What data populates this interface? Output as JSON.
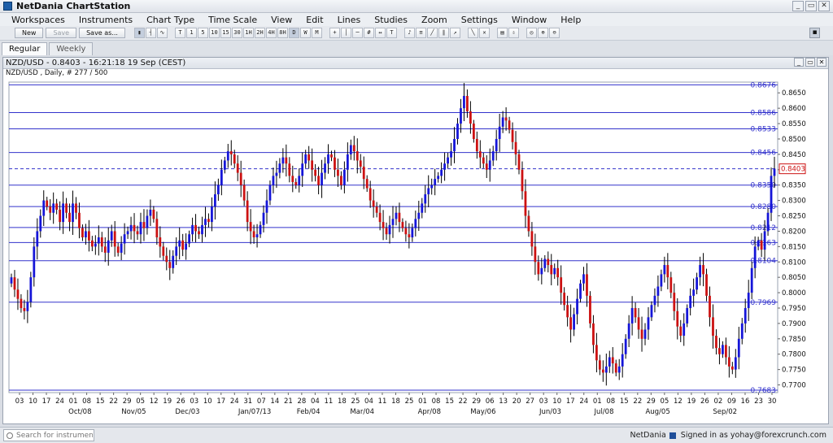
{
  "window": {
    "title": "NetDania ChartStation",
    "buttons": [
      "_",
      "▭",
      "✕"
    ]
  },
  "menu": [
    "Workspaces",
    "Instruments",
    "Chart Type",
    "Time Scale",
    "View",
    "Edit",
    "Lines",
    "Studies",
    "Zoom",
    "Settings",
    "Window",
    "Help"
  ],
  "toolbar": {
    "new_label": "New",
    "save_label": "Save",
    "save_as_label": "Save as...",
    "timescale_buttons": [
      "T",
      "1",
      "5",
      "10",
      "15",
      "30",
      "1H",
      "2H",
      "4H",
      "8H",
      "D",
      "W",
      "M"
    ],
    "active_timescale": "D"
  },
  "tabs": [
    {
      "label": "Regular",
      "active": true
    },
    {
      "label": "Weekly",
      "active": false
    }
  ],
  "chart_window": {
    "title": "NZD/USD - 0.8403 - 16:21:18  19 Sep (CEST)",
    "subtitle": "NZD/USD , Daily, # 277 / 500"
  },
  "status": {
    "search_placeholder": "Search for instrument",
    "brand": "NetDania",
    "signed_in": "Signed in as yohay@forexcrunch.com"
  },
  "chart_data": {
    "type": "candlestick",
    "instrument": "NZD/USD",
    "period": "Daily",
    "ylim": [
      0.7675,
      0.8685
    ],
    "y_ticks": [
      "0.8650",
      "0.8600",
      "0.8550",
      "0.8500",
      "0.8450",
      "0.8400",
      "0.8350",
      "0.8300",
      "0.8250",
      "0.8200",
      "0.8150",
      "0.8100",
      "0.8050",
      "0.8000",
      "0.7950",
      "0.7900",
      "0.7850",
      "0.7800",
      "0.7750",
      "0.7700"
    ],
    "x_tick_labels": [
      "03",
      "10",
      "17",
      "24",
      "01",
      "08",
      "15",
      "22",
      "29",
      "05",
      "12",
      "19",
      "26",
      "03",
      "10",
      "17",
      "24",
      "31",
      "07",
      "14",
      "21",
      "28",
      "04",
      "11",
      "18",
      "25",
      "04",
      "11",
      "18",
      "25",
      "01",
      "08",
      "15",
      "22",
      "29",
      "06",
      "13",
      "20",
      "27",
      "03",
      "10",
      "17",
      "24",
      "01",
      "08",
      "15",
      "22",
      "29",
      "05",
      "12",
      "19",
      "26",
      "02",
      "09",
      "16",
      "23",
      "30"
    ],
    "month_labels": [
      "Oct/08",
      "Nov/05",
      "Dec/03",
      "Jan/07/13",
      "Feb/04",
      "Mar/04",
      "Apr/08",
      "May/06",
      "Jun/03",
      "Jul/08",
      "Aug/05",
      "Sep/02"
    ],
    "horizontal_levels": [
      0.8676,
      0.8586,
      0.8533,
      0.8456,
      0.835,
      0.828,
      0.8212,
      0.8163,
      0.8104,
      0.7969,
      0.7683
    ],
    "horizontal_level_labels": [
      "0.8676",
      "0.8586",
      "0.8533",
      "0.8456",
      "0.8350",
      "0.8280",
      "0.8212",
      "0.8163",
      "0.8104",
      "0.7969",
      "0.7683"
    ],
    "current_price": 0.8403,
    "current_price_label": "0.8403",
    "up_color": "#1515d8",
    "down_color": "#cc1111",
    "level_color": "#3333cc",
    "closes": [
      0.805,
      0.801,
      0.798,
      0.795,
      0.794,
      0.797,
      0.805,
      0.815,
      0.82,
      0.825,
      0.83,
      0.828,
      0.826,
      0.829,
      0.827,
      0.823,
      0.829,
      0.826,
      0.823,
      0.829,
      0.826,
      0.821,
      0.818,
      0.82,
      0.817,
      0.815,
      0.816,
      0.818,
      0.815,
      0.813,
      0.817,
      0.82,
      0.815,
      0.813,
      0.816,
      0.819,
      0.82,
      0.822,
      0.82,
      0.819,
      0.823,
      0.821,
      0.825,
      0.827,
      0.824,
      0.818,
      0.815,
      0.812,
      0.81,
      0.808,
      0.812,
      0.815,
      0.817,
      0.814,
      0.816,
      0.819,
      0.822,
      0.82,
      0.819,
      0.822,
      0.824,
      0.823,
      0.828,
      0.832,
      0.835,
      0.84,
      0.843,
      0.846,
      0.845,
      0.842,
      0.839,
      0.835,
      0.83,
      0.823,
      0.82,
      0.818,
      0.819,
      0.822,
      0.826,
      0.83,
      0.835,
      0.838,
      0.839,
      0.842,
      0.844,
      0.842,
      0.838,
      0.836,
      0.835,
      0.838,
      0.842,
      0.845,
      0.843,
      0.84,
      0.838,
      0.835,
      0.839,
      0.842,
      0.845,
      0.844,
      0.84,
      0.838,
      0.835,
      0.84,
      0.845,
      0.848,
      0.846,
      0.843,
      0.841,
      0.837,
      0.834,
      0.83,
      0.828,
      0.826,
      0.823,
      0.821,
      0.819,
      0.822,
      0.824,
      0.826,
      0.823,
      0.821,
      0.819,
      0.818,
      0.821,
      0.824,
      0.826,
      0.829,
      0.832,
      0.834,
      0.835,
      0.837,
      0.838,
      0.84,
      0.842,
      0.844,
      0.846,
      0.85,
      0.855,
      0.86,
      0.864,
      0.859,
      0.855,
      0.85,
      0.846,
      0.844,
      0.842,
      0.84,
      0.843,
      0.846,
      0.85,
      0.854,
      0.857,
      0.856,
      0.853,
      0.849,
      0.845,
      0.84,
      0.833,
      0.825,
      0.82,
      0.815,
      0.81,
      0.806,
      0.808,
      0.811,
      0.809,
      0.806,
      0.808,
      0.805,
      0.8,
      0.796,
      0.792,
      0.788,
      0.793,
      0.798,
      0.803,
      0.806,
      0.799,
      0.79,
      0.783,
      0.778,
      0.775,
      0.774,
      0.776,
      0.779,
      0.777,
      0.774,
      0.776,
      0.78,
      0.785,
      0.79,
      0.795,
      0.792,
      0.788,
      0.785,
      0.788,
      0.792,
      0.796,
      0.799,
      0.802,
      0.806,
      0.809,
      0.805,
      0.8,
      0.794,
      0.789,
      0.786,
      0.79,
      0.795,
      0.799,
      0.801,
      0.805,
      0.809,
      0.806,
      0.799,
      0.792,
      0.786,
      0.782,
      0.78,
      0.783,
      0.779,
      0.776,
      0.775,
      0.779,
      0.785,
      0.79,
      0.795,
      0.8,
      0.808,
      0.815,
      0.817,
      0.814,
      0.82,
      0.826,
      0.838,
      0.8403
    ]
  }
}
